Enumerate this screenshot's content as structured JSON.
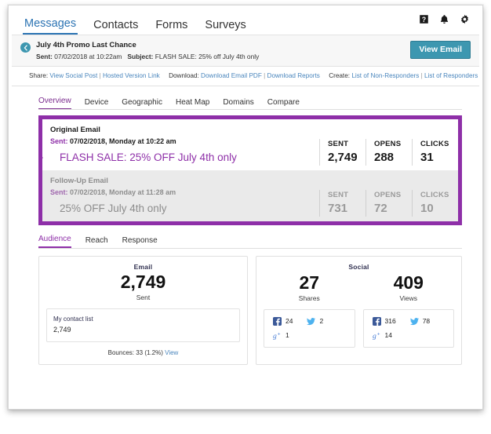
{
  "top_nav": {
    "tabs": [
      {
        "label": "Messages",
        "active": true
      },
      {
        "label": "Contacts",
        "active": false
      },
      {
        "label": "Forms",
        "active": false
      },
      {
        "label": "Surveys",
        "active": false
      }
    ],
    "icons": [
      "help-icon",
      "bell-icon",
      "gear-icon"
    ]
  },
  "email_header": {
    "back_icon": "back-arrow-icon",
    "title": "July 4th Promo Last Chance",
    "sent_label": "Sent:",
    "sent_value": "07/02/2018 at 10:22am",
    "subject_label": "Subject:",
    "subject_value": "FLASH SALE: 25% off July 4th only",
    "view_email_button": "View Email"
  },
  "link_strip": {
    "share_label": "Share:",
    "share_links": [
      "View Social Post",
      "Hosted Version Link"
    ],
    "download_label": "Download:",
    "download_links": [
      "Download Email PDF",
      "Download Reports"
    ],
    "create_label": "Create:",
    "create_links": [
      "List of Non-Responders",
      "List of Responders"
    ],
    "separator": "|"
  },
  "report_tabs": [
    {
      "label": "Overview",
      "active": true
    },
    {
      "label": "Device",
      "active": false
    },
    {
      "label": "Geographic",
      "active": false
    },
    {
      "label": "Heat Map",
      "active": false
    },
    {
      "label": "Domains",
      "active": false
    },
    {
      "label": "Compare",
      "active": false
    }
  ],
  "emails": [
    {
      "title": "Original Email",
      "sent_label": "Sent:",
      "sent_value": "07/02/2018, Monday at 10:22 am",
      "subject": "FLASH SALE: 25% OFF July 4th only",
      "stats": [
        {
          "label": "SENT",
          "value": "2,749"
        },
        {
          "label": "OPENS",
          "value": "288"
        },
        {
          "label": "CLICKS",
          "value": "31"
        }
      ]
    },
    {
      "title": "Follow-Up Email",
      "sent_label": "Sent:",
      "sent_value": "07/02/2018, Monday at 11:28 am",
      "subject": "25% OFF July 4th only",
      "stats": [
        {
          "label": "SENT",
          "value": "731"
        },
        {
          "label": "OPENS",
          "value": "72"
        },
        {
          "label": "CLICKS",
          "value": "10"
        }
      ]
    }
  ],
  "detail_tabs": [
    {
      "label": "Audience",
      "active": true
    },
    {
      "label": "Reach",
      "active": false
    },
    {
      "label": "Response",
      "active": false
    }
  ],
  "audience_card": {
    "heading": "Email",
    "big_number": "2,749",
    "sub_label": "Sent",
    "contact_list_name": "My contact list",
    "contact_list_count": "2,749",
    "bounces_text": "Bounces:  33 (1.2%)",
    "bounces_link": "View"
  },
  "social_card": {
    "heading": "Social",
    "columns": [
      {
        "big_number": "27",
        "sub_label": "Shares",
        "items": [
          {
            "icon": "facebook-icon",
            "count": "24"
          },
          {
            "icon": "twitter-icon",
            "count": "2"
          },
          {
            "icon": "googleplus-icon",
            "count": "1"
          }
        ]
      },
      {
        "big_number": "409",
        "sub_label": "Views",
        "items": [
          {
            "icon": "facebook-icon",
            "count": "316"
          },
          {
            "icon": "twitter-icon",
            "count": "78"
          },
          {
            "icon": "googleplus-icon",
            "count": "14"
          }
        ]
      }
    ]
  },
  "colors": {
    "accent_blue": "#2b73b3",
    "accent_purple": "#8e2fa8",
    "teal": "#3d97b0",
    "facebook": "#3b5998",
    "twitter": "#4db2ef",
    "googleplus": "#4a7fd6",
    "link_blue": "#4a86bd"
  }
}
